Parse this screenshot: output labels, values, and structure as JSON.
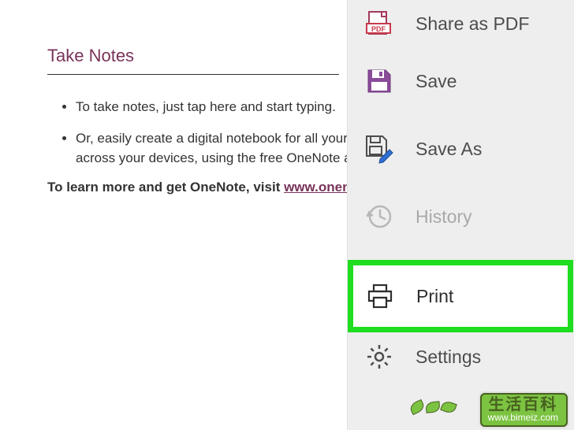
{
  "document": {
    "title": "Take Notes",
    "bullets": [
      "To take notes, just tap here and start typing.",
      "Or, easily create a digital notebook for all your notes that automatically syncs across your devices, using the free OneNote app."
    ],
    "learn_more_prefix": "To learn more and get OneNote, visit ",
    "learn_more_link": "www.onenote.com"
  },
  "menu": {
    "items": [
      {
        "icon": "pdf",
        "label": "Share as PDF",
        "disabled": false
      },
      {
        "icon": "save",
        "label": "Save",
        "disabled": false
      },
      {
        "icon": "saveas",
        "label": "Save As",
        "disabled": false
      },
      {
        "icon": "history",
        "label": "History",
        "disabled": true
      },
      {
        "icon": "print",
        "label": "Print",
        "disabled": false,
        "highlighted": true
      },
      {
        "icon": "settings",
        "label": "Settings",
        "disabled": false
      }
    ]
  },
  "watermark": {
    "top": "生活百科",
    "url": "www.bimeiz.com"
  }
}
